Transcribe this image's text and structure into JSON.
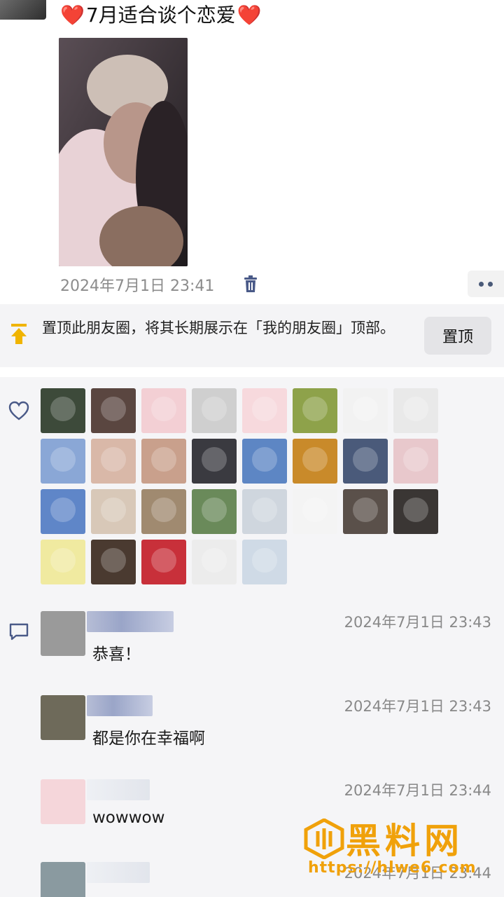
{
  "post": {
    "title_heart": "❤️",
    "title": "7月适合谈个恋爱",
    "timestamp": "2024年7月1日 23:41",
    "icons": {
      "delete": "trash-icon",
      "more": "more-dots-icon"
    }
  },
  "pin_bar": {
    "text": "置顶此朋友圈，将其长期展示在「我的朋友圈」顶部。",
    "button_label": "置顶",
    "icon": "pin-top-icon"
  },
  "likes": {
    "icon": "heart-outline-icon",
    "avatars": [
      {
        "color": "#3d4a3a"
      },
      {
        "color": "#5a4640"
      },
      {
        "color": "#f3cfd4"
      },
      {
        "color": "#cfcfcf"
      },
      {
        "color": "#f7d9dd"
      },
      {
        "color": "#8ea24a"
      },
      {
        "color": "#f2f2f2"
      },
      {
        "color": "#e9e9e9"
      },
      {
        "color": "#8aa7d6"
      },
      {
        "color": "#d9b8a8"
      },
      {
        "color": "#c9a08c"
      },
      {
        "color": "#3a3a40"
      },
      {
        "color": "#5d86c4"
      },
      {
        "color": "#c98a2a"
      },
      {
        "color": "#4a5a7a"
      },
      {
        "color": "#e8c8cc"
      },
      {
        "color": "#5f86c8"
      },
      {
        "color": "#d8c8b8"
      },
      {
        "color": "#a08a70"
      },
      {
        "color": "#6a8a5a"
      },
      {
        "color": "#cfd6de"
      },
      {
        "color": "#f4f4f4"
      },
      {
        "color": "#5a504a"
      },
      {
        "color": "#3a3634"
      },
      {
        "color": "#f0eaa0"
      },
      {
        "color": "#4a3a30"
      },
      {
        "color": "#c8303a"
      },
      {
        "color": "#ececec"
      },
      {
        "color": "#cfdae6"
      }
    ]
  },
  "comments": {
    "icon": "comment-bubble-icon",
    "items": [
      {
        "time": "2024年7月1日 23:43",
        "text": "恭喜！",
        "avatar_color": "#9a9a9a"
      },
      {
        "time": "2024年7月1日 23:43",
        "text": "都是你在幸福啊",
        "avatar_color": "#6e6a5a"
      },
      {
        "time": "2024年7月1日 23:44",
        "text": "wowwow",
        "avatar_color": "#f5d6da"
      },
      {
        "time": "2024年7月1日 23:44",
        "text": "",
        "avatar_color": "#8a9aa0"
      }
    ]
  },
  "watermark": {
    "title": "黑料网",
    "url": "https://hlwe6.com"
  },
  "colors": {
    "heart": "#e0242b",
    "link": "#4a5a78",
    "watermark": "#f0a10a"
  }
}
